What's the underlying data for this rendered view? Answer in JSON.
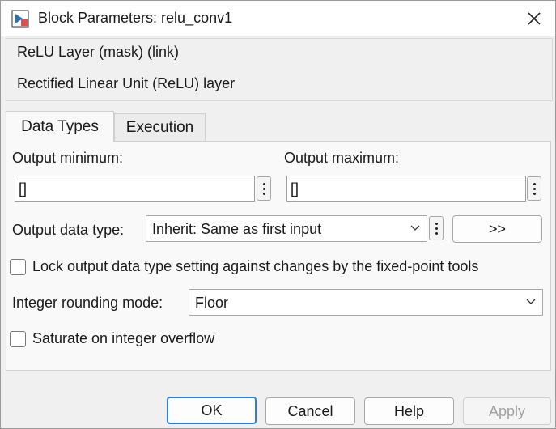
{
  "window": {
    "title": "Block Parameters: relu_conv1",
    "close_icon": "close-icon"
  },
  "description": {
    "legend": "ReLU Layer (mask) (link)",
    "text": "Rectified Linear Unit (ReLU) layer"
  },
  "tabs": [
    {
      "label": "Data Types",
      "selected": true
    },
    {
      "label": "Execution",
      "selected": false
    }
  ],
  "fields": {
    "output_minimum": {
      "label": "Output minimum:",
      "value": "[]"
    },
    "output_maximum": {
      "label": "Output maximum:",
      "value": "[]"
    },
    "output_data_type": {
      "label": "Output data type:",
      "value": "Inherit: Same as first input",
      "assistant_label": ">>"
    },
    "lock_output": {
      "label": "Lock output data type setting against changes by the fixed-point tools",
      "checked": false
    },
    "integer_rounding_mode": {
      "label": "Integer rounding mode:",
      "value": "Floor"
    },
    "saturate": {
      "label": "Saturate on integer overflow",
      "checked": false
    }
  },
  "buttons": {
    "ok": "OK",
    "cancel": "Cancel",
    "help": "Help",
    "apply": "Apply"
  },
  "colors": {
    "accent": "#2b7fd6",
    "background": "#f0f0f0"
  }
}
